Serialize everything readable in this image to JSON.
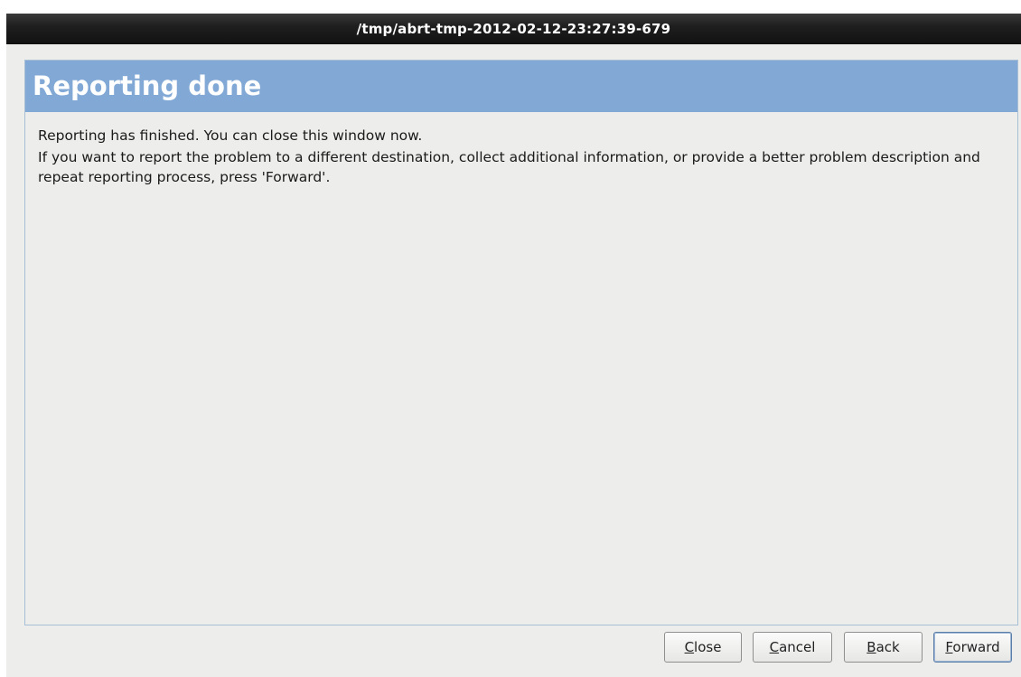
{
  "window": {
    "title": "/tmp/abrt-tmp-2012-02-12-23:27:39-679"
  },
  "page": {
    "heading": "Reporting done",
    "messages": [
      "Reporting has finished. You can close this window now.",
      "If you want to report the problem to a different destination, collect additional information, or provide a better problem description and repeat reporting process, press 'Forward'."
    ]
  },
  "buttons": {
    "close": {
      "mnemonic": "C",
      "rest": "lose"
    },
    "cancel": {
      "mnemonic": "C",
      "rest": "ancel"
    },
    "back": {
      "mnemonic": "B",
      "rest": "ack"
    },
    "forward": {
      "mnemonic": "F",
      "rest": "orward"
    }
  },
  "colors": {
    "header_band": "#82a9d6",
    "titlebar": "#1f1f1f",
    "window_bg": "#ededeb"
  }
}
